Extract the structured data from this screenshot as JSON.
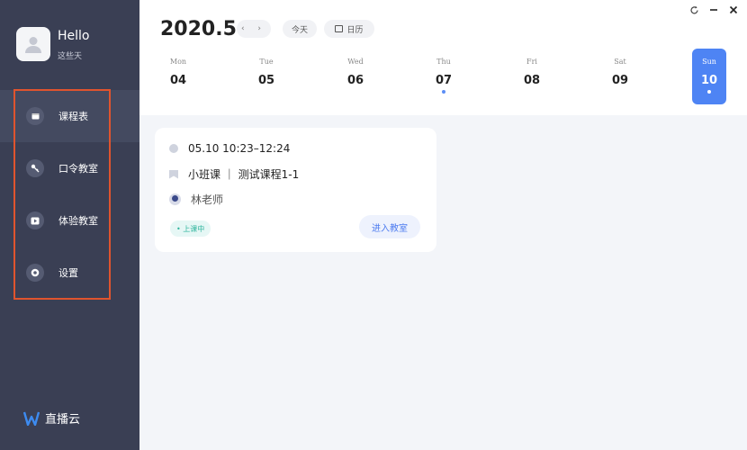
{
  "profile": {
    "greeting": "Hello",
    "subtitle": "这些天"
  },
  "sidebar": {
    "items": [
      {
        "label": "课程表",
        "icon": "calendar-icon"
      },
      {
        "label": "口令教室",
        "icon": "key-icon"
      },
      {
        "label": "体验教室",
        "icon": "play-icon"
      },
      {
        "label": "设置",
        "icon": "settings-icon"
      }
    ],
    "brand": "直播云"
  },
  "header": {
    "year_month": "2020.5",
    "nav_arrows": "‹ ›",
    "today_label": "今天",
    "calendar_label": "日历"
  },
  "week": [
    {
      "name": "Mon",
      "date": "04"
    },
    {
      "name": "Tue",
      "date": "05"
    },
    {
      "name": "Wed",
      "date": "06"
    },
    {
      "name": "Thu",
      "date": "07"
    },
    {
      "name": "Fri",
      "date": "08"
    },
    {
      "name": "Sat",
      "date": "09"
    },
    {
      "name": "Sun",
      "date": "10"
    }
  ],
  "card": {
    "time": "05.10  10:23–12:24",
    "course": "小班课 ｜ 测试课程1-1",
    "teacher": "林老师",
    "status": "• 上课中",
    "enter_label": "进入教室"
  },
  "colors": {
    "sidebar_bg": "#3a3f54",
    "accent": "#4e84f4",
    "highlight_border": "#e0542e",
    "status_green": "#2fb59d"
  }
}
